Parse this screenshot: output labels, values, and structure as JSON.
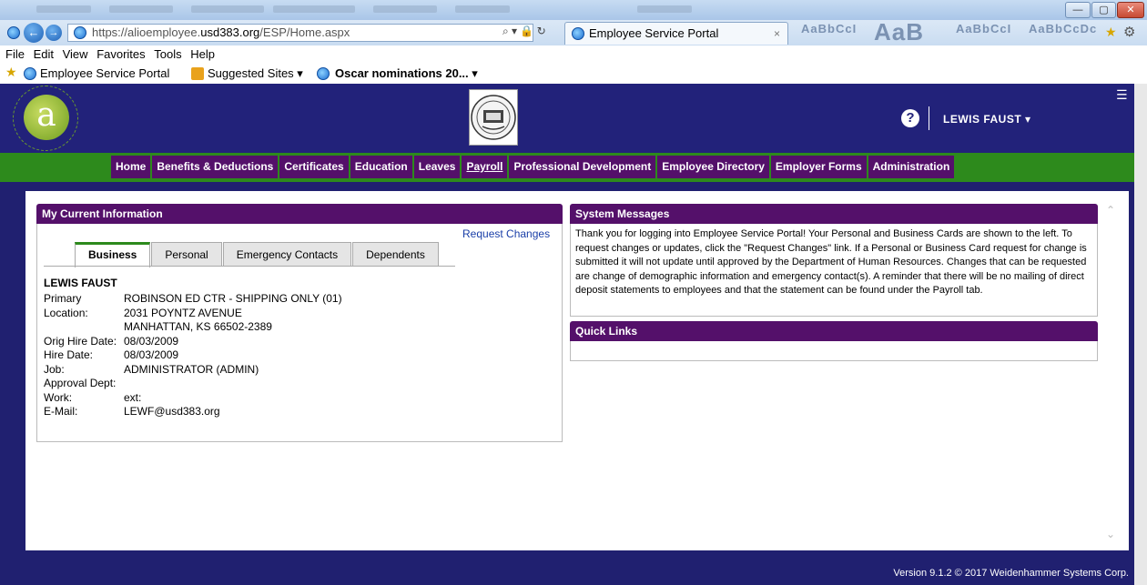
{
  "browser": {
    "url": "https://alioemployee.usd383.org/ESP/Home.aspx",
    "url_prefix": "https://alioemployee.",
    "url_domain": "usd383.org",
    "url_path": "/ESP/Home.aspx",
    "url_controls": "⌕ ▾ 🔒 ↻",
    "tab_title": "Employee Service Portal",
    "win_buttons": [
      "—",
      "▢",
      "✕"
    ],
    "menu": [
      "File",
      "Edit",
      "View",
      "Favorites",
      "Tools",
      "Help"
    ],
    "favorites": [
      {
        "label": "Employee Service Portal",
        "icon": "ie-page-icon"
      },
      {
        "label": "Suggested Sites ▾",
        "icon": "suggested-sites-icon"
      },
      {
        "label": "Oscar nominations 20... ▾",
        "icon": "ie-page-icon",
        "bold": true
      }
    ],
    "blurred_right": [
      "AaB",
      "AaBbCcI",
      "AaBbCcDc"
    ]
  },
  "header": {
    "logo_letter": "a",
    "logo_ring_text": "EMPLOYEE SERVICE PORTAL",
    "help_glyph": "?",
    "user_name": "LEWIS FAUST ▾"
  },
  "nav": [
    {
      "label": "Home"
    },
    {
      "label": "Benefits & Deductions"
    },
    {
      "label": "Certificates"
    },
    {
      "label": "Education"
    },
    {
      "label": "Leaves"
    },
    {
      "label": "Payroll",
      "active": true
    },
    {
      "label": "Professional Development"
    },
    {
      "label": "Employee Directory"
    },
    {
      "label": "Employer Forms"
    },
    {
      "label": "Administration"
    }
  ],
  "current_info": {
    "title": "My Current Information",
    "request_changes": "Request Changes",
    "tabs": [
      "Business",
      "Personal",
      "Emergency Contacts",
      "Dependents"
    ],
    "name": "LEWIS FAUST",
    "rows": [
      {
        "label": "Primary",
        "value": "ROBINSON ED CTR - SHIPPING ONLY (01)"
      },
      {
        "label": "Location:",
        "value": "2031 POYNTZ AVENUE"
      },
      {
        "label": "",
        "value": "MANHATTAN, KS 66502-2389"
      },
      {
        "label": "Orig Hire Date:",
        "value": "08/03/2009"
      },
      {
        "label": "Hire Date:",
        "value": "08/03/2009"
      },
      {
        "label": "Job:",
        "value": "ADMINISTRATOR (ADMIN)"
      },
      {
        "label": "Approval Dept:",
        "value": ""
      },
      {
        "label": "Work:",
        "value": "ext:"
      },
      {
        "label": "E-Mail:",
        "value": "LEWF@usd383.org"
      }
    ]
  },
  "system_messages": {
    "title": "System Messages",
    "text": "Thank you for logging into Employee Service Portal!  Your Personal and Business Cards are shown to the left. To request changes or updates, click the \"Request Changes\" link. If a Personal or Business Card request for change is submitted it will not update until approved by the Department of Human Resources.  Changes that can be requested are change of demographic information and emergency contact(s).  A reminder that there will be no mailing of direct deposit statements to employees and that the statement can be found under the Payroll tab."
  },
  "quick_links": {
    "title": "Quick Links"
  },
  "footer": {
    "text": "Version 9.1.2  © 2017 Weidenhammer Systems Corp."
  }
}
